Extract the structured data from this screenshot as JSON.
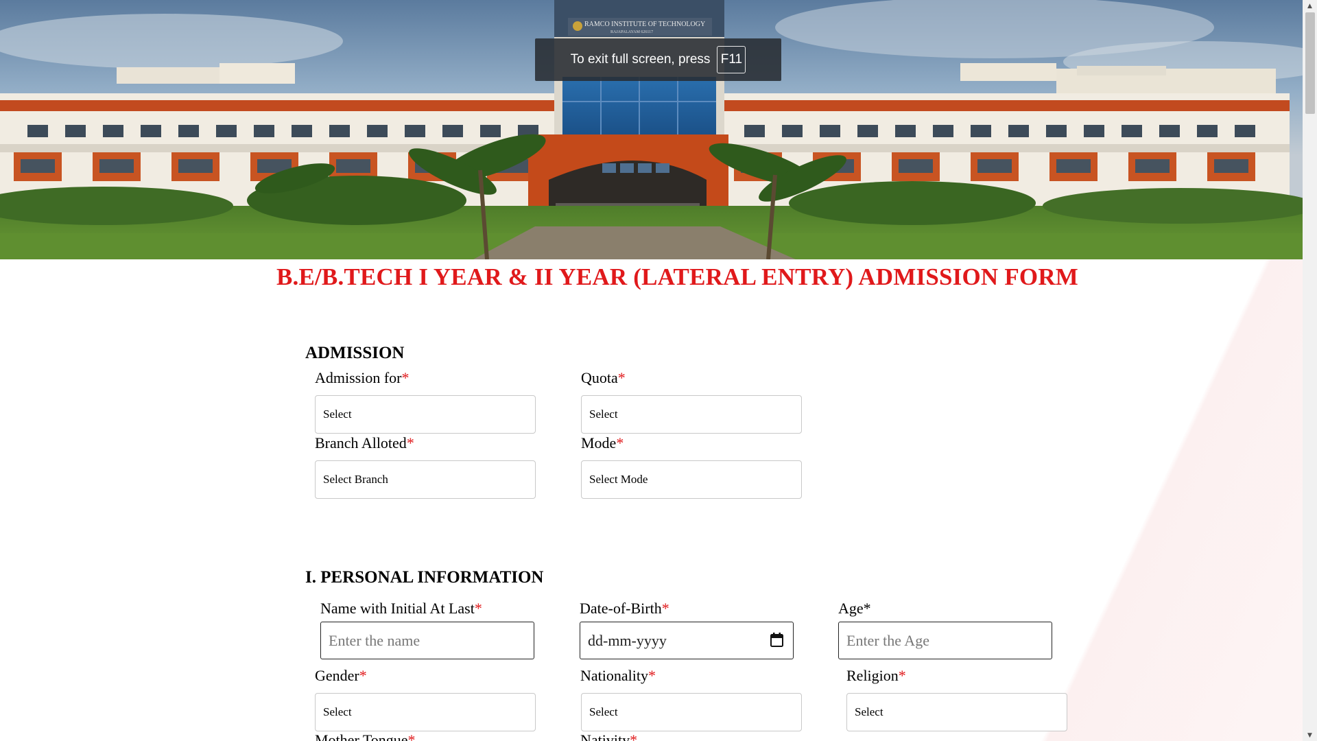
{
  "banner": {
    "campus_sign": "RAMCO INSTITUTE OF TECHNOLOGY",
    "campus_sign_sub": "RAJAPALAYAM   626117"
  },
  "fullscreen_notice": {
    "text": "To exit full screen, press",
    "key": "F11"
  },
  "form": {
    "title": "B.E/B.TECH I YEAR & II YEAR (LATERAL ENTRY) ADMISSION FORM",
    "required_mark": "*",
    "admission": {
      "heading": "ADMISSION",
      "admission_for": {
        "label": "Admission for",
        "value": "Select"
      },
      "quota": {
        "label": "Quota",
        "value": "Select"
      },
      "branch": {
        "label": "Branch Alloted",
        "value": "Select Branch"
      },
      "mode": {
        "label": "Mode",
        "value": "Select Mode"
      }
    },
    "personal": {
      "heading": "I. PERSONAL INFORMATION",
      "name": {
        "label": "Name with Initial At Last",
        "placeholder": "Enter the name"
      },
      "dob": {
        "label": "Date-of-Birth",
        "value": "dd-mm-yyyy"
      },
      "age": {
        "label": "Age",
        "placeholder": "Enter the Age"
      },
      "gender": {
        "label": "Gender",
        "value": "Select"
      },
      "nationality": {
        "label": "Nationality",
        "value": "Select"
      },
      "religion": {
        "label": "Religion",
        "value": "Select"
      },
      "mother_tongue": {
        "label": "Mother Tongue"
      },
      "nativity": {
        "label": "Nativity"
      }
    }
  },
  "colors": {
    "title_red": "#e0191b",
    "required_red": "#e0191b",
    "toast_bg": "#282c32"
  }
}
